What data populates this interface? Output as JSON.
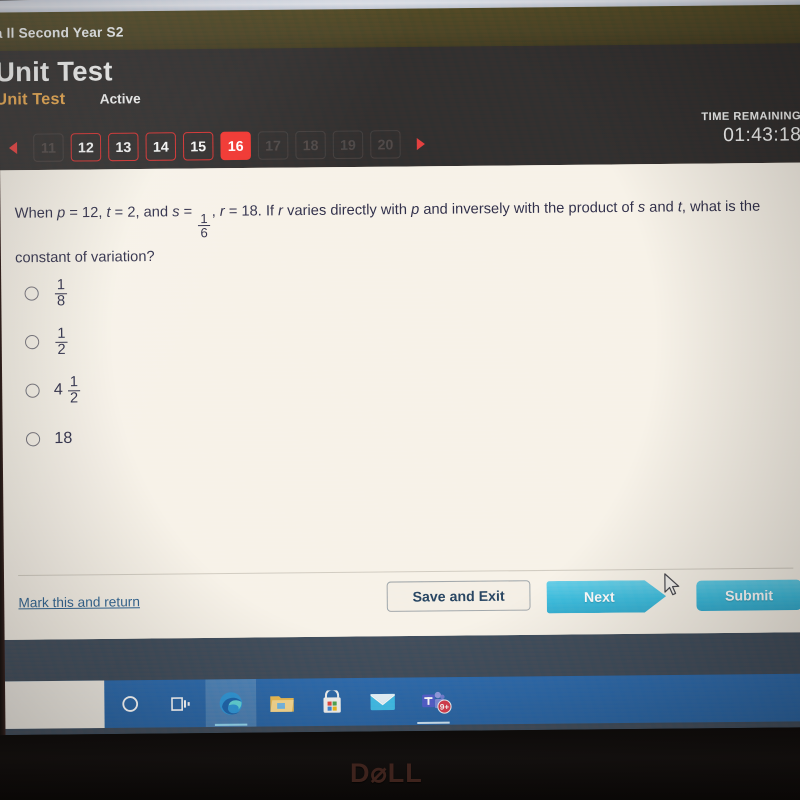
{
  "course_bar": {
    "title": "a ll Second Year S2"
  },
  "header": {
    "page_title": "Unit Test",
    "tab_unit_label": "Unit Test",
    "tab_status_label": "Active",
    "prev_arrow": "prev-arrow-icon",
    "next_arrow": "next-arrow-icon",
    "pills": [
      {
        "label": "11",
        "state": "dim"
      },
      {
        "label": "12",
        "state": "normal"
      },
      {
        "label": "13",
        "state": "normal"
      },
      {
        "label": "14",
        "state": "normal"
      },
      {
        "label": "15",
        "state": "normal"
      },
      {
        "label": "16",
        "state": "current"
      },
      {
        "label": "17",
        "state": "dim"
      },
      {
        "label": "18",
        "state": "dim"
      },
      {
        "label": "19",
        "state": "dim"
      },
      {
        "label": "20",
        "state": "dim"
      }
    ]
  },
  "timer": {
    "label": "TIME REMAINING",
    "value": "01:43:18"
  },
  "question": {
    "part1": "When ",
    "p_var": "p",
    "p_eq": " = 12, ",
    "t_var": "t",
    "t_eq": " = 2, and ",
    "s_var": "s",
    "s_eq": " = ",
    "s_num": "1",
    "s_den": "6",
    "r_lead": ", ",
    "r_var": "r",
    "r_eq": " = 18. If ",
    "r_var2": "r",
    "mid": " varies directly with ",
    "p_var2": "p",
    "mid2": " and inversely with the product of ",
    "s_var2": "s",
    "and": " and ",
    "t_var2": "t",
    "tail": ", what is the constant of variation?",
    "full_text": "When p = 12, t = 2, and s = 1/6, r = 18. If r varies directly with p and inversely with the product of s and t, what is the constant of variation?"
  },
  "options": [
    {
      "id": "a",
      "whole": "",
      "num": "1",
      "den": "8",
      "plain": "1/8",
      "selected": false
    },
    {
      "id": "b",
      "whole": "",
      "num": "1",
      "den": "2",
      "plain": "1/2",
      "selected": false
    },
    {
      "id": "c",
      "whole": "4",
      "num": "1",
      "den": "2",
      "plain": "4 1/2",
      "selected": false
    },
    {
      "id": "d",
      "whole": "18",
      "num": "",
      "den": "",
      "plain": "18",
      "selected": false
    }
  ],
  "footer": {
    "mark_link": "Mark this and return",
    "save_label": "Save and Exit",
    "next_label": "Next",
    "submit_label": "Submit"
  },
  "taskbar": {
    "search_placeholder": "",
    "items": [
      {
        "name": "cortana-icon",
        "badge": ""
      },
      {
        "name": "task-view-icon",
        "badge": ""
      },
      {
        "name": "edge-browser-icon",
        "badge": ""
      },
      {
        "name": "file-explorer-icon",
        "badge": ""
      },
      {
        "name": "microsoft-store-icon",
        "badge": ""
      },
      {
        "name": "mail-icon",
        "badge": ""
      },
      {
        "name": "microsoft-teams-icon",
        "badge": "9+"
      }
    ]
  },
  "monitor": {
    "brand": "D⌀LL"
  },
  "colors": {
    "accent_red": "#f0332f",
    "accent_orange": "#e7a04a",
    "accent_cyan": "#3cb9dd",
    "header_dark": "#2f2c2c",
    "course_bar": "#4e4524",
    "taskbar_blue": "#2d64a8",
    "paper": "#f7f1e7",
    "link_blue": "#2d5c8a"
  }
}
